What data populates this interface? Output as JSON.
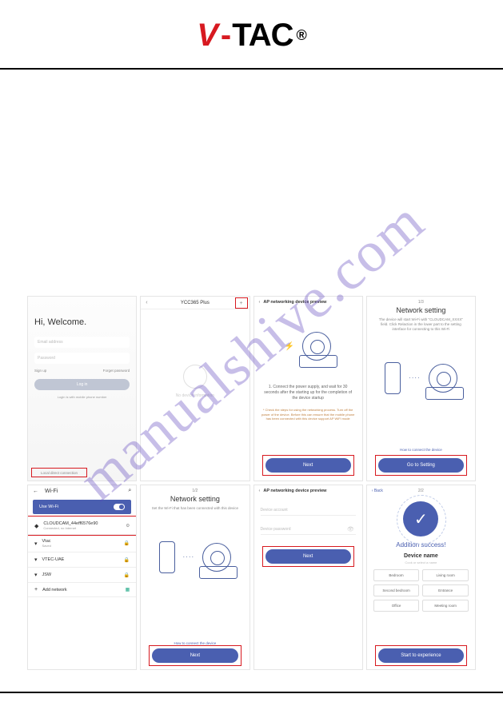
{
  "brand": {
    "name": "V-TAC",
    "registered": "®"
  },
  "watermark": "manualshive.com",
  "screens": {
    "welcome": {
      "title": "Hi, Welcome.",
      "email_placeholder": "Email address",
      "password_placeholder": "Password",
      "signup": "Sign up",
      "forgot": "Forget password",
      "login_btn": "Log in",
      "sub": "Login is with mobile phone number",
      "local_direct": "Local direct connection"
    },
    "ycc": {
      "title": "YCC365 Plus",
      "no_device": "No device information"
    },
    "ap_preview": {
      "title": "AP networking device preview",
      "instruction": "1. Connect the power supply, and wait for 30 seconds after the starting up for the completion of the device startup",
      "warning": "* Check the steps for using the networking process. Turn off the power of the device. Before this can ensure that the mobile phone has been connected with this device support AP WiFi mode",
      "next": "Next"
    },
    "net1": {
      "step": "1/3",
      "title": "Network setting",
      "desc": "The device will start Wi-Fi with \"CLOUDCAM_XXXX\" field. Click Relaction in the lower part to the setting interface for connecting to this Wi-Fi",
      "how": "How to connect the device",
      "btn": "Go to Setting"
    },
    "wifi": {
      "title": "Wi-Fi",
      "use": "Use Wi-Fi",
      "cloudcam": "CLOUDCAM_44eff6576e90",
      "cloudcam_sub": "Connected, no Internet",
      "n1": "Vtac",
      "n1_sub": "Saved",
      "n2": "VTEC-UAE",
      "n3": "JSW",
      "add": "Add network"
    },
    "net2": {
      "step": "1/2",
      "title": "Network setting",
      "desc": "Set the Wi-Fi that has been connected with this device",
      "how": "How to connect the device",
      "btn": "Next"
    },
    "ap_inputs": {
      "title": "AP networking device preview",
      "f1": "Device account",
      "f2": "Device password",
      "btn": "Next"
    },
    "success": {
      "back": "Back",
      "step": "2/2",
      "title": "Addition success!",
      "device_name": "Device name",
      "hint": "Cook or select a name",
      "opts": [
        "Bedroom",
        "Living room",
        "Second bedroom",
        "Entrance",
        "Office",
        "Meeting room"
      ],
      "btn": "Start to experience"
    }
  }
}
